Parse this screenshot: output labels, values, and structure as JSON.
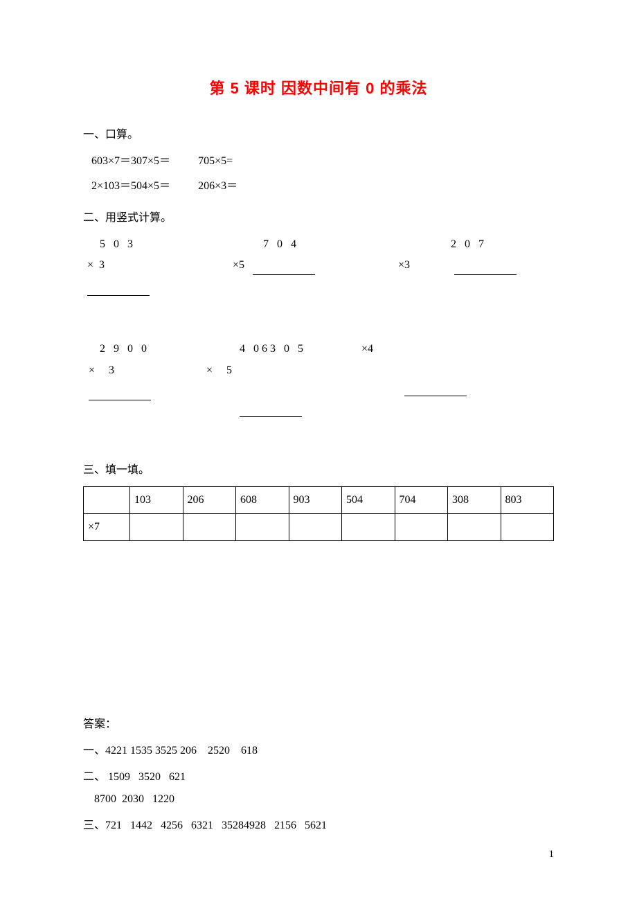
{
  "title": "第 5 课时  因数中间有 0 的乘法",
  "section1": {
    "heading": "一、口算。",
    "row1a": "603×7＝307×5＝",
    "row1b": "705×5=",
    "row2a": "2×103＝504×5＝",
    "row2b": "206×3＝"
  },
  "section2": {
    "heading": "二、用竖式计算。",
    "row1": [
      {
        "top": "5 0 3",
        "bottom": "×  3",
        "style": "a"
      },
      {
        "top": "7 0 4",
        "bottom": "×5",
        "style": "b"
      },
      {
        "top": "2 0 7",
        "bottom": "×3",
        "style": "c"
      }
    ],
    "row2": [
      {
        "top": "2 9 0 0",
        "bottom": "×     3",
        "style": "a"
      },
      {
        "top": "4 063 0 5",
        "bottom": "×     5",
        "style": "b"
      },
      {
        "top": "",
        "bottom": "×4",
        "style": "c"
      }
    ]
  },
  "section3": {
    "heading": "三、填一填。",
    "headers": [
      "",
      "103",
      "206",
      "608",
      "903",
      "504",
      "704",
      "308",
      "803"
    ],
    "rowLabel": "×7"
  },
  "answers": {
    "heading": "答案：",
    "a1": "一、4221 1535 3525 206    2520    618",
    "a2": "二、 1509   3520   621",
    "a2b": "    8700  2030   1220",
    "a3": "三、721   1442   4256   6321   35284928   2156   5621"
  },
  "pageNumber": "1"
}
